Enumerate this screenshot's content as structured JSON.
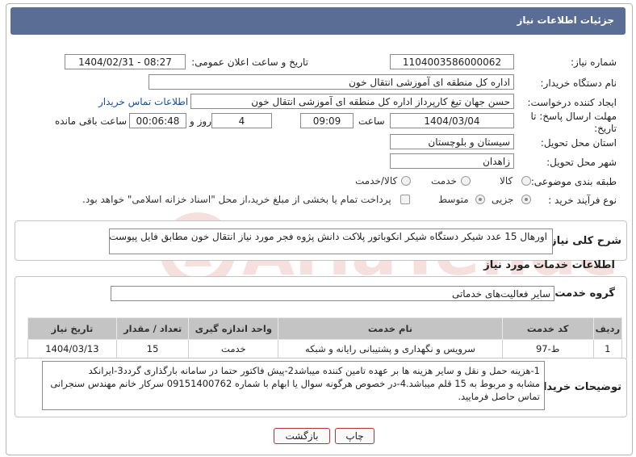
{
  "header": {
    "title": "جزئیات اطلاعات نیاز"
  },
  "fields": {
    "need_number_label": "شماره نیاز:",
    "need_number": "1104003586000062",
    "announce_label": "تاریخ و ساعت اعلان عمومی:",
    "announce_value": "1404/02/31 - 08:27",
    "buyer_org_label": "نام دستگاه خریدار:",
    "buyer_org": "اداره کل منطقه ای آموزشی انتقال خون",
    "creator_label": "ایجاد کننده درخواست:",
    "creator": "حسن جهان تیغ کارپرداز اداره کل منطقه ای آموزشی انتقال خون",
    "contact_link": "اطلاعات تماس خریدار",
    "deadline_label_1": "مهلت ارسال پاسخ: تا",
    "deadline_label_2": "تاریخ:",
    "deadline_date": "1404/03/04",
    "time_label": "ساعت",
    "deadline_time": "09:09",
    "days_value": "4",
    "days_label": "روز و",
    "remaining_time": "00:06:48",
    "remaining_label": "ساعت باقی مانده",
    "province_label": "استان محل تحویل:",
    "province": "سیستان و بلوچستان",
    "city_label": "شهر محل تحویل:",
    "city": "زاهدان",
    "category_label": "طبقه بندی موضوعی:",
    "category_options": [
      "کالا",
      "خدمت",
      "کالا/خدمت"
    ],
    "process_label": "نوع فرآیند خرید :",
    "process_options": [
      "جزیی",
      "متوسط"
    ],
    "treasury_note": "پرداخت تمام یا بخشی از مبلغ خرید،از محل \"اسناد خزانه اسلامی\" خواهد بود."
  },
  "description": {
    "label": "شرح کلی نیاز:",
    "text": "اورهال  15 عدد  شیکر دستگاه شیکر انکوباتور پلاکت دانش پژوه فجر مورد نیاز انتقال خون مطابق فایل پیوست"
  },
  "services": {
    "section_title": "اطلاعات خدمات مورد نیاز",
    "group_label": "گروه خدمت:",
    "group_value": "سایر فعالیت‌های خدماتی",
    "columns": [
      "ردیف",
      "کد خدمت",
      "نام خدمت",
      "واحد اندازه گیری",
      "تعداد / مقدار",
      "تاریخ نیاز"
    ],
    "rows": [
      [
        "1",
        "ط-97",
        "سرویس و نگهداری و پشتیبانی رایانه و شبکه",
        "خدمت",
        "15",
        "1404/03/13"
      ]
    ]
  },
  "buyer_notes": {
    "label": "توضیحات خریدار:",
    "lines": [
      "1-هزینه حمل و نقل و سایر هزینه ها  بر عهده تامین کننده میباشد2-پیش فاکتور حتما در سامانه بارگذاری گردد3-ایرانکد",
      "مشابه و مربوط به 15 قلم میباشد.4-در خصوص هرگونه سوال یا ابهام با شماره 09151400762 سرکار خانم مهندس سنجرانی",
      "تماس حاصل فرمایید."
    ]
  },
  "buttons": {
    "print": "چاپ",
    "back": "بازگشت"
  },
  "watermark": {
    "text": "AriaTender.net"
  },
  "colors": {
    "header_bg": "#5a6d94",
    "link": "#1a4fa0",
    "button_border": "#b7333a",
    "watermark": "#c0392b"
  }
}
